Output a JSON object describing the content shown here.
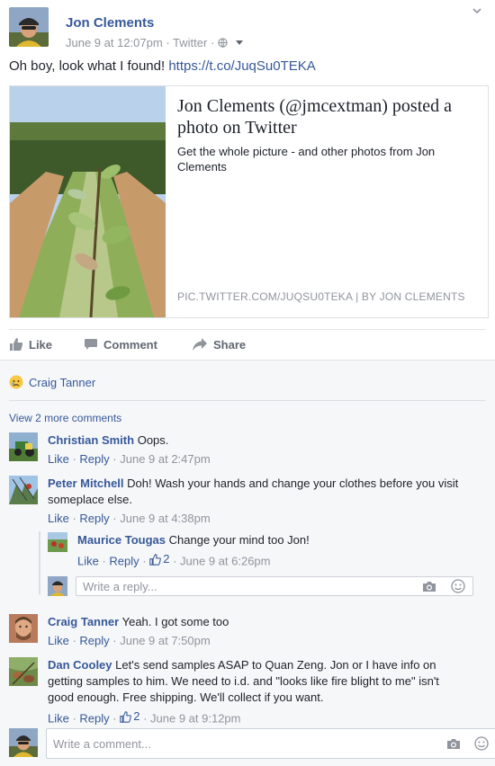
{
  "post": {
    "author": "Jon Clements",
    "timestamp": "June 9 at 12:07pm",
    "source": "Twitter",
    "text_prefix": "Oh boy, look what I found!",
    "link_text": "https://t.co/JuqSu0TEKA"
  },
  "link_card": {
    "title": "Jon Clements (@jmcextman) posted a photo on Twitter",
    "description": "Get the whole picture - and other photos from Jon Clements",
    "source_line": "PIC.TWITTER.COM/JUQSU0TEKA | BY JON CLEMENTS"
  },
  "actions": {
    "like": "Like",
    "comment": "Comment",
    "share": "Share"
  },
  "reactions": {
    "name": "Craig Tanner"
  },
  "view_more": "View 2 more comments",
  "comments": [
    {
      "name": "Christian Smith",
      "text": "Oops.",
      "like": "Like",
      "reply": "Reply",
      "time": "June 9 at 2:47pm"
    },
    {
      "name": "Peter Mitchell",
      "text": "Doh! Wash your hands and change your clothes before you visit",
      "text2": "someplace else.",
      "like": "Like",
      "reply": "Reply",
      "time": "June 9 at 4:38pm"
    },
    {
      "name": "Maurice Tougas",
      "text": "Change your mind too Jon!",
      "like": "Like",
      "reply": "Reply",
      "likes": "2",
      "time": "June 9 at 6:26pm"
    },
    {
      "name": "Craig Tanner",
      "text": "Yeah. I got some too",
      "like": "Like",
      "reply": "Reply",
      "time": "June 9 at 7:50pm"
    },
    {
      "name": "Dan Cooley",
      "text": "Let's send samples ASAP to Quan Zeng. Jon or I have info on",
      "text2": "getting samples to him. We need to i.d. and \"looks like fire blight to me\" isn't",
      "text3": "good enough. Free shipping. We'll collect if you want.",
      "like": "Like",
      "reply": "Reply",
      "likes": "2",
      "time": "June 9 at 9:12pm"
    }
  ],
  "reply_input": {
    "placeholder": "Write a reply..."
  },
  "comment_input": {
    "placeholder": "Write a comment..."
  },
  "separator": " · "
}
